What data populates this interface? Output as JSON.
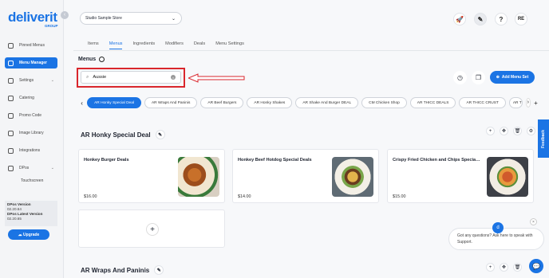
{
  "brand": {
    "name": "deliverit",
    "sub": "GROUP"
  },
  "sidebar": {
    "items": [
      {
        "label": "Pinned Menus"
      },
      {
        "label": "Menu Manager"
      },
      {
        "label": "Settings"
      },
      {
        "label": "Catering"
      },
      {
        "label": "Promo Code"
      },
      {
        "label": "Image Library"
      },
      {
        "label": "Integrations"
      },
      {
        "label": "DPos"
      }
    ],
    "sub_item": "Touchscreen",
    "version": {
      "label1": "DPos Version",
      "value1": "02.20.64",
      "label2": "DPos Latest Version",
      "value2": "02.20.65"
    },
    "upgrade_label": "Upgrade"
  },
  "header": {
    "store": "Studio Sample Store",
    "avatar": "RE",
    "help": "?"
  },
  "tabs": [
    "Items",
    "Menus",
    "Ingredients",
    "Modifiers",
    "Deals",
    "Menu Settings"
  ],
  "menus_title": "Menus",
  "search": {
    "value": "Aussie"
  },
  "add_menu_label": "Add Menu Set",
  "chips": [
    "AR Honky Special Deal",
    "AR Wraps And Paninis",
    "AR Beef Burgers",
    "AR Honky Shakes",
    "AR Shake And Burger DEAL",
    "CM Chicken Shop",
    "AR THICC DEALS",
    "AR THICC CRUST",
    "AR T"
  ],
  "sections": [
    {
      "title": "AR Honky Special Deal",
      "cards": [
        {
          "title": "Honkey Burger Deals",
          "price": "$16.00"
        },
        {
          "title": "Honkey Beef Hotdog Special Deals",
          "price": "$14.00"
        },
        {
          "title": "Crispy Fried Chicken and Chips Special De...",
          "price": "$15.00"
        }
      ]
    },
    {
      "title": "AR Wraps And Paninis"
    }
  ],
  "feedback": "Feedback",
  "support": {
    "text": "Got any questions? Ask here to speak with Support."
  },
  "colors": {
    "accent": "#1b74e4",
    "highlight": "#d9262c"
  }
}
